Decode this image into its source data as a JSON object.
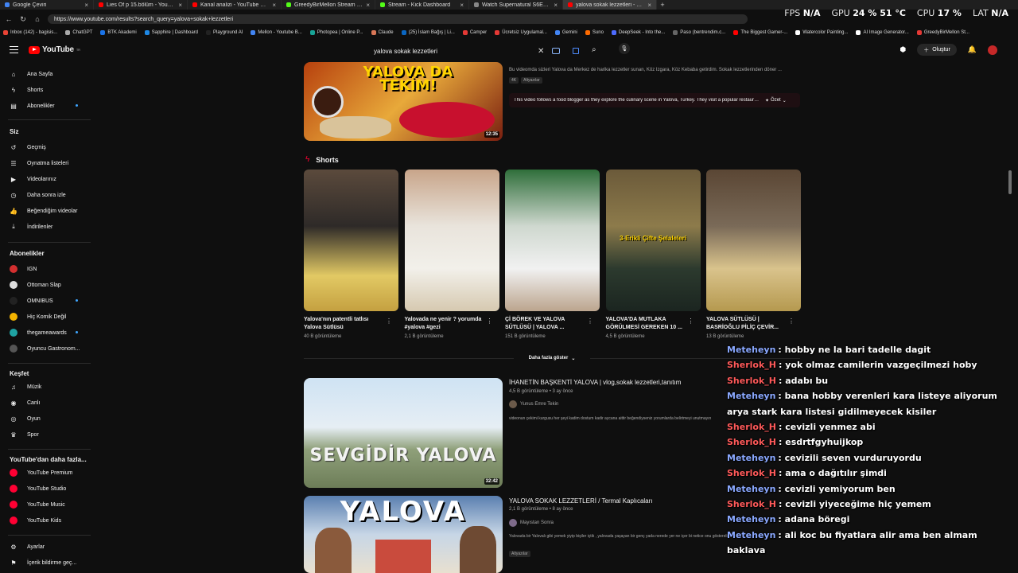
{
  "browser": {
    "tabs": [
      {
        "label": "Google Çeviri",
        "color": "#4285f4",
        "active": false
      },
      {
        "label": "Lies Of p 15.bölüm - YouTube",
        "color": "#ff0000",
        "active": false
      },
      {
        "label": "Kanal analizi - YouTube Studio",
        "color": "#ff0000",
        "active": false
      },
      {
        "label": "GreedyBirMellon Stream - Watch",
        "color": "#53fc18",
        "active": false
      },
      {
        "label": "Stream - Kick Dashboard",
        "color": "#53fc18",
        "active": false
      },
      {
        "label": "Watch Supernatural S6E13 online",
        "color": "#888888",
        "active": false
      },
      {
        "label": "yalova sokak lezzetleri - YouTube",
        "color": "#ff0000",
        "active": true
      }
    ],
    "url": "https://www.youtube.com/results?search_query=yalova+sokak+lezzetleri",
    "bookmarks": [
      {
        "label": "Inbox (142) - bagisis...",
        "color": "#ea4335"
      },
      {
        "label": "ChatGPT",
        "color": "#aaaaaa"
      },
      {
        "label": "BTK Akademi",
        "color": "#1a73e8"
      },
      {
        "label": "Sapphire | Dashboard",
        "color": "#1e88e5"
      },
      {
        "label": "Playground AI",
        "color": "#222222"
      },
      {
        "label": "Mellon - Youtube B...",
        "color": "#4285f4"
      },
      {
        "label": "Photopea | Online P...",
        "color": "#18a497"
      },
      {
        "label": "Claude",
        "color": "#d97757"
      },
      {
        "label": "(25) İslam Bağış | Li...",
        "color": "#0a66c2"
      },
      {
        "label": "Camper",
        "color": "#e53935"
      },
      {
        "label": "Ücretsiz Uygulamal...",
        "color": "#e53935"
      },
      {
        "label": "Gemini",
        "color": "#4285f4"
      },
      {
        "label": "Suno",
        "color": "#ff6b00"
      },
      {
        "label": "DeepSeek - Into the...",
        "color": "#4d6bfe"
      },
      {
        "label": "Paso (bentrendim.c...",
        "color": "#666666"
      },
      {
        "label": "The Biggest Gamer-...",
        "color": "#ff0000"
      },
      {
        "label": "Watercolor Painting...",
        "color": "#ffffff"
      },
      {
        "label": "AI Image Generator...",
        "color": "#ffffff"
      },
      {
        "label": "GreedyBirMellon St...",
        "color": "#e53935"
      }
    ],
    "perf": {
      "fps_label": "FPS",
      "fps_value": "N/A",
      "gpu_label": "GPU",
      "gpu_value": "24 % 51 °C",
      "cpu_label": "CPU",
      "cpu_value": "17 %",
      "lat_label": "LAT",
      "lat_value": "N/A"
    }
  },
  "header": {
    "logo": "YouTube",
    "logo_region": "TR",
    "search_value": "yalova sokak lezzetleri",
    "create_label": "Oluştur"
  },
  "sidebar": {
    "main": [
      {
        "label": "Ana Sayfa",
        "icon": "home-icon",
        "glyph": "⌂"
      },
      {
        "label": "Shorts",
        "icon": "shorts-icon",
        "glyph": "ϟ"
      },
      {
        "label": "Abonelikler",
        "icon": "subscriptions-icon",
        "glyph": "▤"
      }
    ],
    "you_header": "Siz",
    "you": [
      {
        "label": "Geçmiş",
        "icon": "history-icon",
        "glyph": "↺"
      },
      {
        "label": "Oynatma listeleri",
        "icon": "playlists-icon",
        "glyph": "☰"
      },
      {
        "label": "Videolarınız",
        "icon": "your-videos-icon",
        "glyph": "▶"
      },
      {
        "label": "Daha sonra izle",
        "icon": "watch-later-icon",
        "glyph": "◷"
      },
      {
        "label": "Beğendiğim videolar",
        "icon": "liked-icon",
        "glyph": "👍"
      },
      {
        "label": "İndirilenler",
        "icon": "downloads-icon",
        "glyph": "⤓"
      }
    ],
    "subs_header": "Abonelikler",
    "subs": [
      {
        "label": "IGN",
        "color": "#d32f2f"
      },
      {
        "label": "Ottoman Slap",
        "color": "#dddddd"
      },
      {
        "label": "OMNIBUS",
        "color": "#222222"
      },
      {
        "label": "Hiç Komik Değil",
        "color": "#f4b400"
      },
      {
        "label": "thegameawards",
        "color": "#1fa3a3"
      },
      {
        "label": "Oyuncu Gastronom...",
        "color": "#555555"
      }
    ],
    "explore_header": "Keşfet",
    "explore": [
      {
        "label": "Müzik",
        "icon": "music-icon",
        "glyph": "♫"
      },
      {
        "label": "Canlı",
        "icon": "live-icon",
        "glyph": "◉"
      },
      {
        "label": "Oyun",
        "icon": "gaming-icon",
        "glyph": "◎"
      },
      {
        "label": "Spor",
        "icon": "trophy-icon",
        "glyph": "♛"
      }
    ],
    "more_header": "YouTube'dan daha fazla...",
    "more": [
      {
        "label": "YouTube Premium"
      },
      {
        "label": "YouTube Studio"
      },
      {
        "label": "YouTube Music"
      },
      {
        "label": "YouTube Kids"
      }
    ],
    "bottom": [
      {
        "label": "Ayarlar",
        "icon": "settings-icon",
        "glyph": "⚙"
      },
      {
        "label": "İçerik bildirme geç...",
        "icon": "flag-icon",
        "glyph": "⚑"
      }
    ]
  },
  "results": {
    "top_video": {
      "thumb_text": "YALOVA DA TEKİM!",
      "duration": "12:35",
      "description": "Bu videomda sizleri Yalova da Merkez de harika lezzetler sunan, Köz Izgara, Köz Kebaba getirdim. Sokak lezzetlerinden döner ...",
      "chips": [
        "4K",
        "Altyazılar"
      ],
      "summary": "This video follows a food blogger as they explore the culinary scene in Yalova, Turkey. They visit a popular restauran...",
      "summary_button": "Özet"
    },
    "shorts_title": "Shorts",
    "shorts": [
      {
        "title": "Yalova'nın patentli tatlısı Yalova Sütlüsü",
        "views": "40 B görüntüleme",
        "overlay": ""
      },
      {
        "title": "Yalovada ne yenir ? yorumda #yalova #gezi",
        "views": "2,1 B görüntüleme",
        "overlay": ""
      },
      {
        "title": "Çİ BÖREK VE YALOVA SÜTLÜSÜ | YALOVA ...",
        "views": "151 B görüntüleme",
        "overlay": ""
      },
      {
        "title": "YALOVA'DA MUTLAKA GÖRÜLMESİ GEREKEN 10 ...",
        "views": "4,5 B görüntüleme",
        "overlay": "3-Erikli Çifte Şelaleleri"
      },
      {
        "title": "YALOVA SÜTLÜSÜ | BASRİOĞLU PİLİÇ ÇEVİR...",
        "views": "13 B görüntüleme",
        "overlay": ""
      }
    ],
    "show_more": "Daha fazla göster",
    "videos": [
      {
        "title": "İHANETİN BAŞKENTİ YALOVA | vlog,sokak lezzetleri,tanıtım",
        "meta": "4,5 B görüntüleme • 3 ay önce",
        "channel": "Yunus Emre Tekin",
        "description": "videonun çekimi kurgusu her şeyi kadim dostum kadir aycana aittir beğendiyseniz yorumlarda belirtmeyi unutmayın",
        "duration": "32:42",
        "thumb_text": "SEVGİDİR YALOVA"
      },
      {
        "title": "YALOVA SOKAK LEZZETLERİ / Termal Kaplıcaları",
        "meta": "2,1 B görüntüleme • 8 ay önce",
        "channel": "Mayıstan Sonra",
        "description": "Yalovada bir Yalovalı gibi yemek yiyip bişiler içtik , yalovada yaşayan bir genç yada nerede yer ne içer bi netice onu gösterelim",
        "chips": [
          "Altyazılar"
        ],
        "thumb_text": "YALOVA"
      }
    ]
  },
  "chat": [
    {
      "user": "Metehеyn",
      "u": 1,
      "msg": ": hobby ne la bari tadelle dagit"
    },
    {
      "user": "Sherlok_H",
      "u": 2,
      "msg": ": yok olmaz camilerin vazgeçilmezi hoby"
    },
    {
      "user": "Sherlok_H",
      "u": 2,
      "msg": ": adabı bu"
    },
    {
      "user": "Metehеyn",
      "u": 1,
      "msg": ": bana hobby verenleri kara listeye aliyorum arya stark kara listesi gidilmeyecek kisiler"
    },
    {
      "user": "Sherlok_H",
      "u": 2,
      "msg": ": cevizli yenmez abi"
    },
    {
      "user": "Sherlok_H",
      "u": 2,
      "msg": ": esdrtfgyhuijkop"
    },
    {
      "user": "Metehеyn",
      "u": 1,
      "msg": ": cevizili seven vurduruyordu"
    },
    {
      "user": "Sherlok_H",
      "u": 2,
      "msg": ": ama o dağıtılır şimdi"
    },
    {
      "user": "Metehеyn",
      "u": 1,
      "msg": ": cevizli yemiyorum ben"
    },
    {
      "user": "Sherlok_H",
      "u": 2,
      "msg": ": cevizli yiyeceğime hiç yemem"
    },
    {
      "user": "Metehеyn",
      "u": 1,
      "msg": ": adana böregi"
    },
    {
      "user": "Metehеyn",
      "u": 1,
      "msg": ": ali koc bu fiyatlara alir ama ben almam baklava"
    }
  ]
}
